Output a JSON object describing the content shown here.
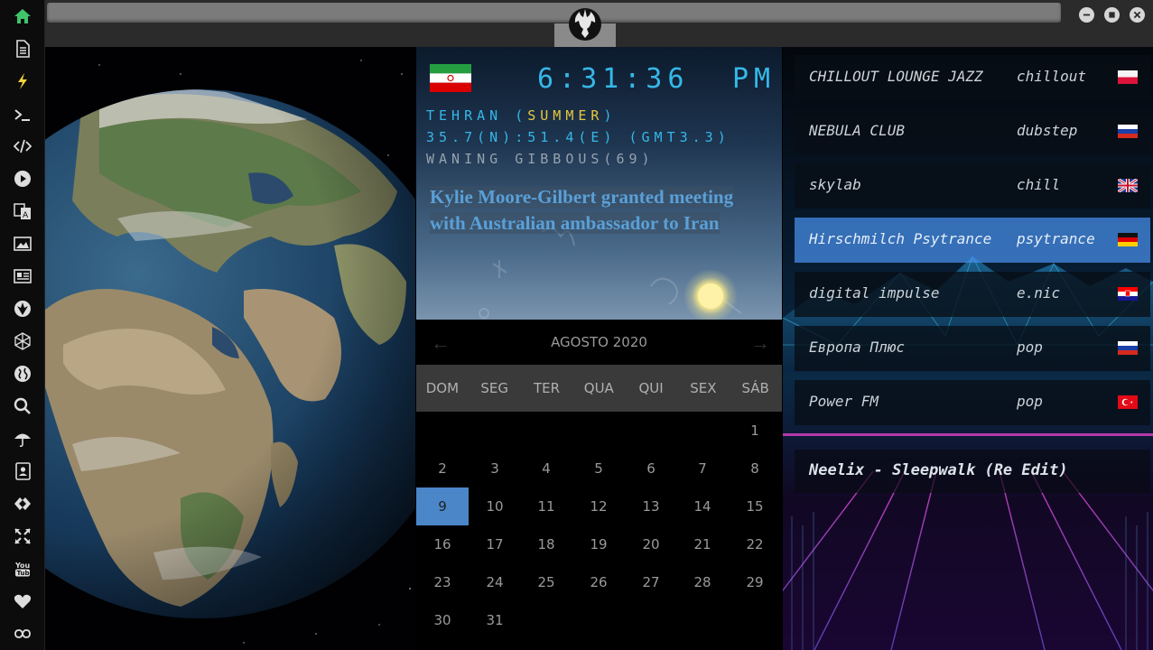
{
  "sidebar": {
    "items": [
      {
        "icon": "home-icon",
        "color": "#3fc46a"
      },
      {
        "icon": "document-icon"
      },
      {
        "icon": "lightning-icon",
        "color": "#f2d33a"
      },
      {
        "icon": "terminal-icon"
      },
      {
        "icon": "code-icon"
      },
      {
        "icon": "play-circle-icon"
      },
      {
        "icon": "translate-icon"
      },
      {
        "icon": "image-icon"
      },
      {
        "icon": "newspaper-icon"
      },
      {
        "icon": "rebel-alliance-icon"
      },
      {
        "icon": "hexagon-network-icon"
      },
      {
        "icon": "globe-icon"
      },
      {
        "icon": "search-icon"
      },
      {
        "icon": "umbrella-icon"
      },
      {
        "icon": "contacts-book-icon"
      },
      {
        "icon": "link-diamond-icon"
      },
      {
        "icon": "expand-arrows-icon"
      },
      {
        "icon": "youtube-icon"
      },
      {
        "icon": "heart-icon"
      },
      {
        "icon": "infinity-cloud-icon"
      }
    ]
  },
  "window": {
    "logo": "rebel-alliance-icon"
  },
  "clock": {
    "time": "6:31:36",
    "ampm": "PM",
    "city": "TEHRAN",
    "season": "SUMMER",
    "coords": "35.7(N):51.4(E) (GMT3.3)",
    "moon": "WANING GIBBOUS(69)",
    "flag": "iran-flag"
  },
  "news": {
    "headline": "Kylie Moore-Gilbert granted meeting with Australian ambassador to Iran"
  },
  "calendar": {
    "month": "AGOSTO 2020",
    "weekdays": [
      "DOM",
      "SEG",
      "TER",
      "QUA",
      "QUI",
      "SEX",
      "SÁB"
    ],
    "today": "9",
    "days": [
      "1",
      "2",
      "3",
      "4",
      "5",
      "6",
      "7",
      "8",
      "9",
      "10",
      "11",
      "12",
      "13",
      "14",
      "15",
      "16",
      "17",
      "18",
      "19",
      "20",
      "21",
      "22",
      "23",
      "24",
      "25",
      "26",
      "27",
      "28",
      "29",
      "30",
      "31"
    ]
  },
  "radio": {
    "stations": [
      {
        "name": "CHILLOUT LOUNGE JAZZ",
        "genre": "chillout",
        "flag": "poland-flag"
      },
      {
        "name": "NEBULA CLUB",
        "genre": "dubstep",
        "flag": "russia-flag"
      },
      {
        "name": "skylab",
        "genre": "chill",
        "flag": "uk-flag"
      },
      {
        "name": "Hirschmilch Psytrance",
        "genre": "psytrance",
        "flag": "germany-flag"
      },
      {
        "name": "digital impulse",
        "genre": "e.nic",
        "flag": "croatia-flag"
      },
      {
        "name": "Европа Плюс",
        "genre": "pop",
        "flag": "russia-flag"
      },
      {
        "name": "Power FM",
        "genre": "pop",
        "flag": "turkey-flag"
      }
    ],
    "now_playing": "Neelix - Sleepwalk (Re Edit)"
  }
}
